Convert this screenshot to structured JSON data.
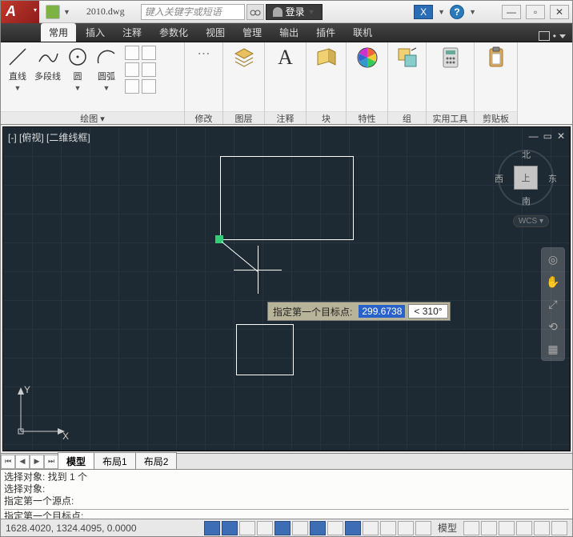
{
  "title": "2010.dwg",
  "search_placeholder": "键入关键字或短语",
  "login": "登录",
  "tabs": [
    "常用",
    "插入",
    "注释",
    "参数化",
    "视图",
    "管理",
    "输出",
    "插件",
    "联机"
  ],
  "panels": {
    "draw": {
      "label": "绘图 ▾",
      "items": [
        "直线",
        "多段线",
        "圆",
        "圆弧"
      ]
    },
    "modify": {
      "label": "修改"
    },
    "layer": {
      "label": "图层"
    },
    "annotate": {
      "label": "注释"
    },
    "block": {
      "label": "块"
    },
    "props": {
      "label": "特性"
    },
    "group": {
      "label": "组"
    },
    "util": {
      "label": "实用工具"
    },
    "clip": {
      "label": "剪贴板"
    }
  },
  "view_label": "[-] [俯视] [二维线框]",
  "viewcube": {
    "top": "上",
    "n": "北",
    "s": "南",
    "e": "东",
    "w": "西",
    "wcs": "WCS ▾"
  },
  "dyn": {
    "label": "指定第一个目标点:",
    "val": "299.6738",
    "ang": "< 310°"
  },
  "layout": {
    "model": "模型",
    "l1": "布局1",
    "l2": "布局2"
  },
  "cmd": {
    "h1": "选择对象: 找到 1 个",
    "h2": "选择对象:",
    "h3": "指定第一个源点:",
    "cur": "指定第一个目标点:"
  },
  "coords": "1628.4020, 1324.4095, 0.0000",
  "status_model": "模型",
  "ucs": {
    "x": "X",
    "y": "Y"
  }
}
